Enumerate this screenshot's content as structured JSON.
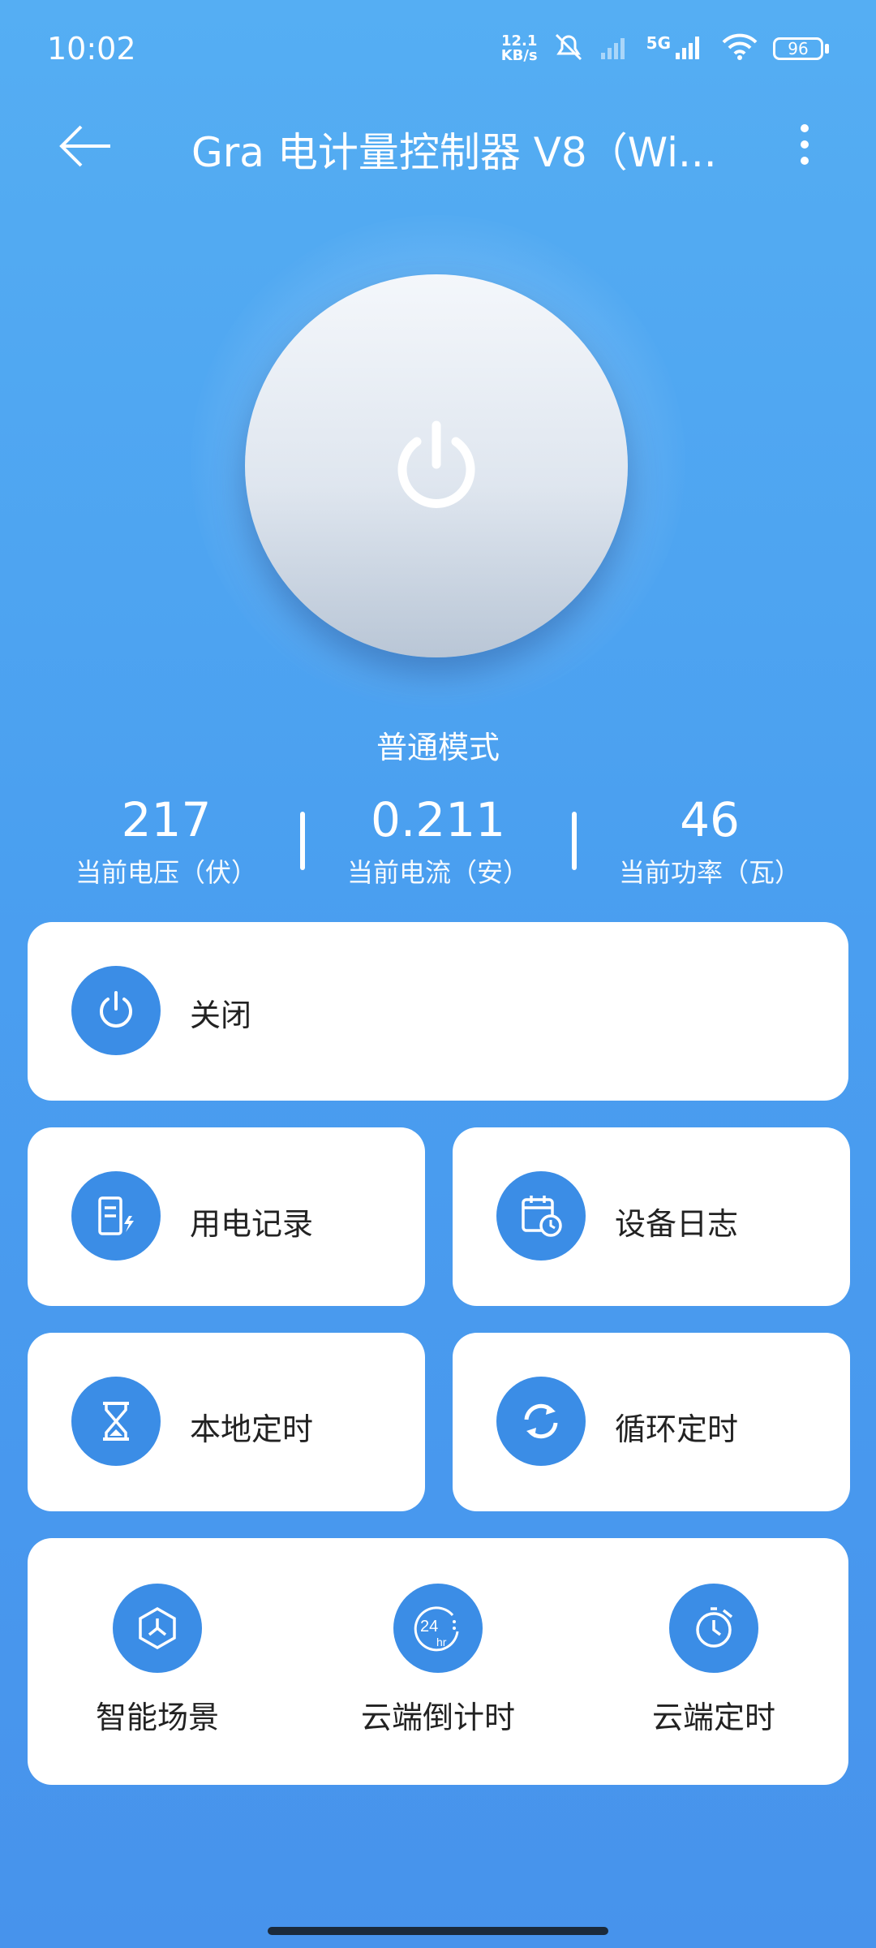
{
  "status_bar": {
    "time": "10:02",
    "net_speed_value": "12.1",
    "net_speed_unit": "KB/s",
    "network": "5G",
    "battery": "96"
  },
  "app_bar": {
    "title": "Gra 电计量控制器 V8（Wi..."
  },
  "power": {
    "mode": "普通模式"
  },
  "stats": [
    {
      "value": "217",
      "label": "当前电压（伏）"
    },
    {
      "value": "0.211",
      "label": "当前电流（安）"
    },
    {
      "value": "46",
      "label": "当前功率（瓦）"
    }
  ],
  "actions": {
    "off": "关闭",
    "usage_records": "用电记录",
    "device_log": "设备日志",
    "local_timer": "本地定时",
    "cycle_timer": "循环定时"
  },
  "bottom": {
    "smart_scene": "智能场景",
    "cloud_countdown": "云端倒计时",
    "cloud_timer": "云端定时"
  },
  "icons": [
    "back-arrow-icon",
    "more-vert-icon",
    "power-icon",
    "meter-icon",
    "calendar-clock-icon",
    "hourglass-icon",
    "cycle-icon",
    "scene-icon",
    "countdown-24hr-icon",
    "alarm-clock-icon"
  ],
  "colors": {
    "accent": "#3b8de6",
    "background": "#4a9ff0"
  }
}
